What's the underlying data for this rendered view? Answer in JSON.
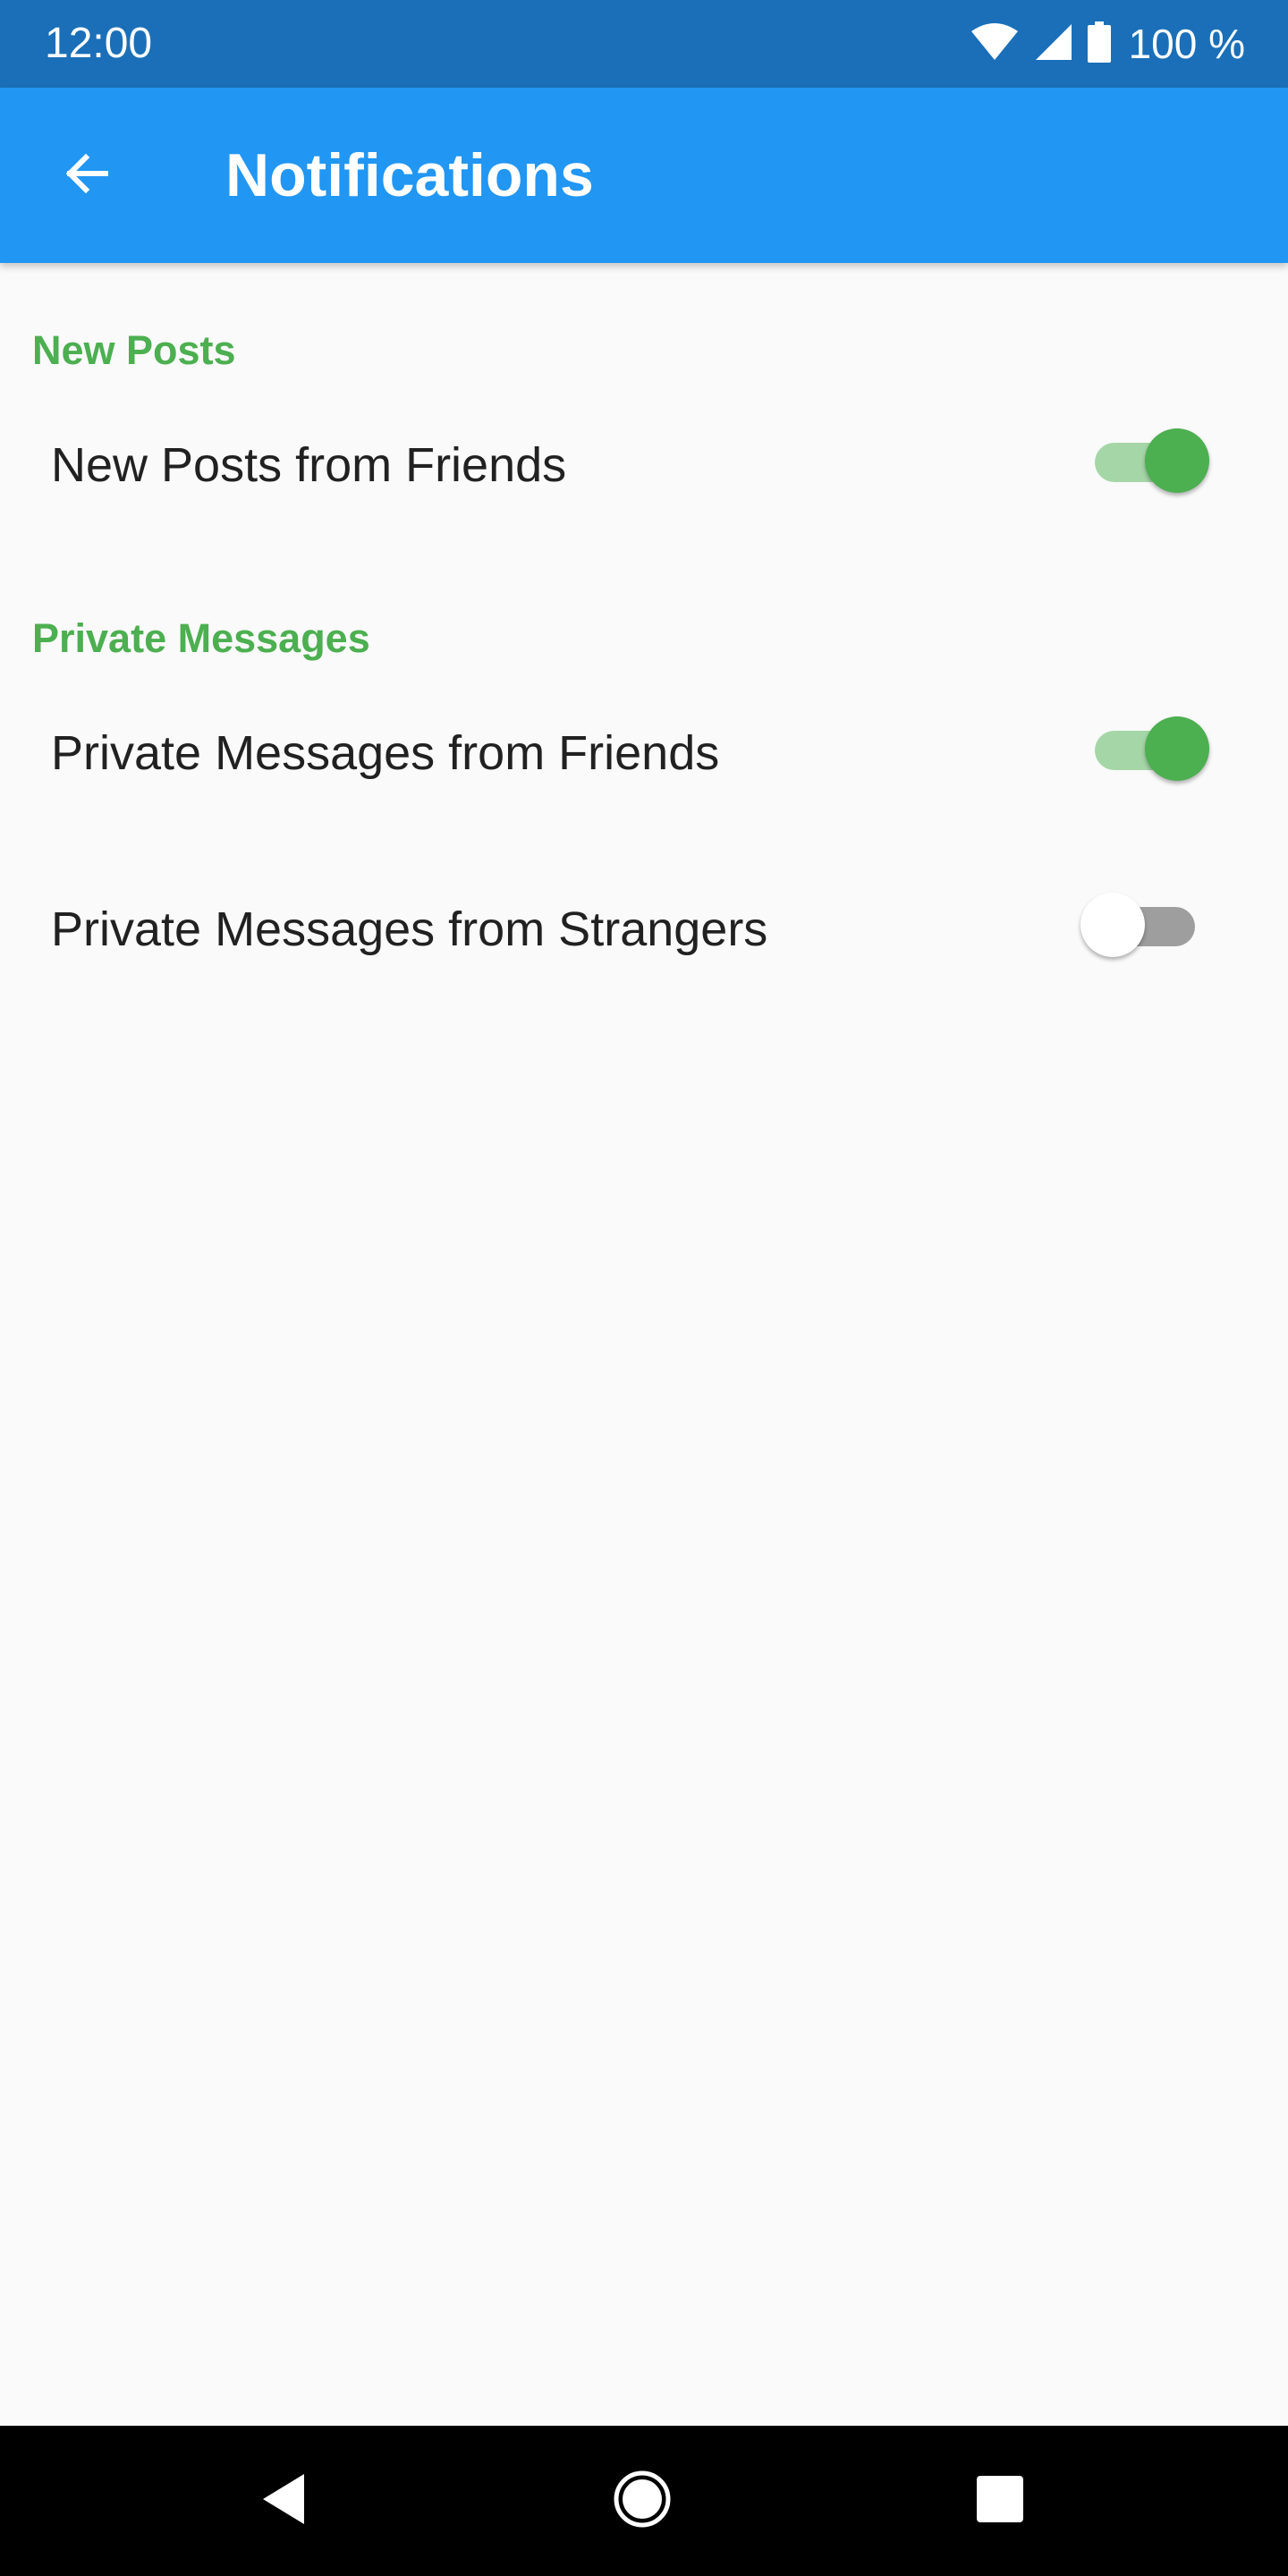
{
  "status_bar": {
    "time": "12:00",
    "battery_text": "100 %",
    "icons": [
      "wifi-icon",
      "cell-signal-icon",
      "battery-icon"
    ]
  },
  "app_bar": {
    "title": "Notifications",
    "back_icon": "arrow-back-icon",
    "color": "#2196f3"
  },
  "sections": [
    {
      "header": "New Posts",
      "items": [
        {
          "label": "New Posts from Friends",
          "enabled": true
        }
      ]
    },
    {
      "header": "Private Messages",
      "items": [
        {
          "label": "Private Messages from Friends",
          "enabled": true
        },
        {
          "label": "Private Messages from Strangers",
          "enabled": false
        }
      ]
    }
  ],
  "colors": {
    "status_bar": "#1a6fb8",
    "accent": "#4caf50",
    "background": "#fafafa"
  },
  "nav_bar": {
    "buttons": [
      "back-triangle-icon",
      "home-circle-icon",
      "recents-square-icon"
    ]
  }
}
